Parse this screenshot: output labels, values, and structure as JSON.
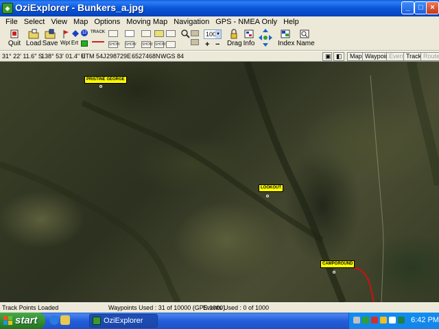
{
  "window": {
    "title": "OziExplorer - Bunkers_a.jpg",
    "min_glyph": "_",
    "max_glyph": "□",
    "close_glyph": "×"
  },
  "menu": [
    "File",
    "Select",
    "View",
    "Map",
    "Options",
    "Moving Map",
    "Navigation",
    "GPS - NMEA Only",
    "Help"
  ],
  "toolbar": {
    "quit": "Quit",
    "load": "Load",
    "save": "Save",
    "wpt": "Wpt",
    "ert": "Ert",
    "badge_12": "12",
    "track": "TRACK",
    "show1": "SHOW",
    "show2": "SHOW",
    "show3": "SHOW",
    "show4": "SHOW",
    "zoom": "100",
    "zoom_in": "+",
    "zoom_out": "−",
    "drag": "Drag",
    "info": "Info",
    "index": "Index",
    "name": "Name"
  },
  "position": {
    "lat": "31° 22' 11.6\" S",
    "lon": "138° 53' 01.4\" E",
    "utm": "UTM  54J",
    "easting": "298729E",
    "northing": "6527468N",
    "datum": "WGS 84"
  },
  "objects": {
    "map": "Map",
    "waypoint": "Waypoint",
    "event": "Event",
    "track": "Track",
    "route": "Route"
  },
  "waypoints": [
    {
      "name": "PRISTINE GEORGE"
    },
    {
      "name": "LOOKOUT"
    },
    {
      "name": "CAMPGROUND"
    }
  ],
  "status": {
    "track_points": "Track Points Loaded",
    "waypoints_used": "Waypoints Used : 31 of 10000  (GPS:1000)",
    "events_used": "Events Used : 0 of 1000"
  },
  "taskbar": {
    "start": "start",
    "task": "OziExplorer",
    "clock": "6:42 PM"
  },
  "colors": {
    "waypoint_label": "#ffff00",
    "track_line": "#d01010",
    "titlebar": "#0a56d8"
  }
}
